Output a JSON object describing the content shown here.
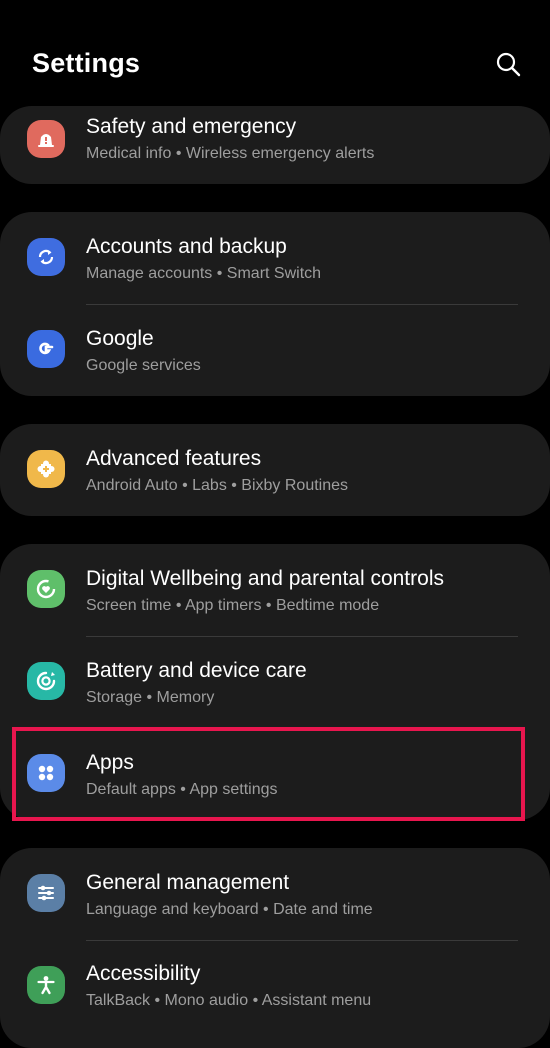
{
  "header": {
    "title": "Settings",
    "search_icon": "search-icon"
  },
  "colors": {
    "background": "#000000",
    "card": "#1c1c1c",
    "highlight": "#e8164e",
    "safety": "#e06a5e",
    "accounts": "#3f6de0",
    "google": "#3a6be0",
    "advanced": "#f0b84a",
    "wellbeing": "#5fbf6a",
    "battery": "#27b8a6",
    "apps": "#5b8be8",
    "general": "#5b7fa6",
    "accessibility": "#3f9f58"
  },
  "items": {
    "safety": {
      "label": "Safety and emergency",
      "sub": "Medical info  •  Wireless emergency alerts",
      "icon": "siren-icon"
    },
    "accounts": {
      "label": "Accounts and backup",
      "sub": "Manage accounts  •  Smart Switch",
      "icon": "sync-icon"
    },
    "google": {
      "label": "Google",
      "sub": "Google services",
      "icon": "google-icon"
    },
    "advanced": {
      "label": "Advanced features",
      "sub": "Android Auto  •  Labs  •  Bixby Routines",
      "icon": "puzzle-plus-icon"
    },
    "wellbeing": {
      "label": "Digital Wellbeing and parental controls",
      "sub": "Screen time  •  App timers  •  Bedtime mode",
      "icon": "heart-ring-icon"
    },
    "battery": {
      "label": "Battery and device care",
      "sub": "Storage  •  Memory",
      "icon": "device-care-icon"
    },
    "apps": {
      "label": "Apps",
      "sub": "Default apps  •  App settings",
      "icon": "apps-grid-icon"
    },
    "general": {
      "label": "General management",
      "sub": "Language and keyboard  •  Date and time",
      "icon": "sliders-icon"
    },
    "accessibility": {
      "label": "Accessibility",
      "sub": "TalkBack  •  Mono audio  •  Assistant menu",
      "icon": "person-icon"
    }
  }
}
